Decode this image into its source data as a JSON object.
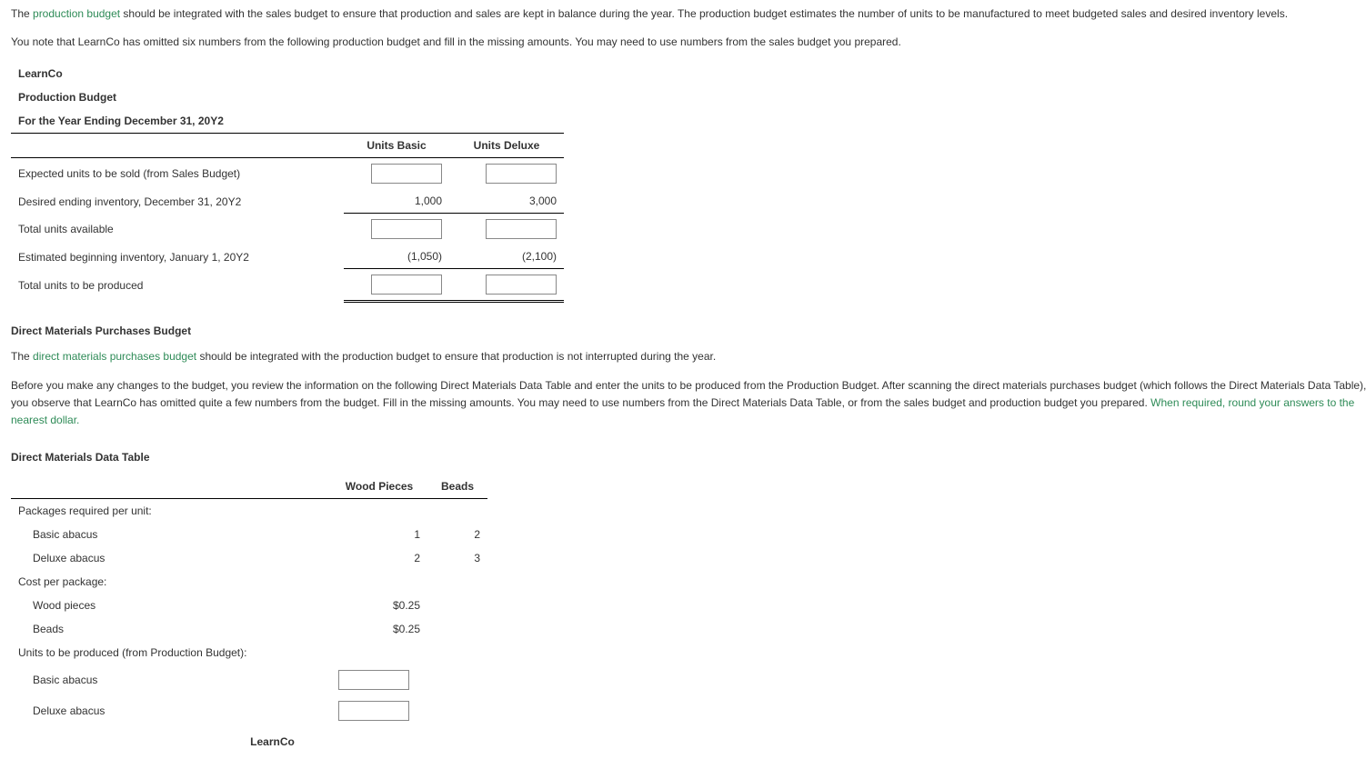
{
  "intro": {
    "p1_a": "The ",
    "p1_link": "production budget",
    "p1_b": " should be integrated with the sales budget to ensure that production and sales are kept in balance during the year. The production budget estimates the number of units to be manufactured to meet budgeted sales and desired inventory levels.",
    "p2": "You note that LearnCo has omitted six numbers from the following production budget and fill in the missing amounts. You may need to use numbers from the sales budget you prepared."
  },
  "prod_budget": {
    "title1": "LearnCo",
    "title2": "Production Budget",
    "title3": "For the Year Ending December 31, 20Y2",
    "col_basic": "Units Basic",
    "col_deluxe": "Units Deluxe",
    "rows": {
      "expected": "Expected units to be sold (from Sales Budget)",
      "desired": "Desired ending inventory, December 31, 20Y2",
      "desired_basic": "1,000",
      "desired_deluxe": "3,000",
      "total_avail": "Total units available",
      "begin_inv": "Estimated beginning inventory, January 1, 20Y2",
      "begin_basic": "(1,050)",
      "begin_deluxe": "(2,100)",
      "total_prod": "Total units to be produced"
    }
  },
  "dm_section": {
    "heading": "Direct Materials Purchases Budget",
    "p1_a": "The ",
    "p1_link": "direct materials purchases budget",
    "p1_b": " should be integrated with the production budget to ensure that production is not interrupted during the year.",
    "p2_a": "Before you make any changes to the budget, you review the information on the following Direct Materials Data Table and enter the units to be produced from the Production Budget. After scanning the direct materials purchases budget (which follows the Direct Materials Data Table), you observe that LearnCo has omitted quite a few numbers from the budget. Fill in the missing amounts. You may need to use numbers from the Direct Materials Data Table, or from the sales budget and production budget you prepared. ",
    "p2_hint": "When required, round your answers to the nearest dollar."
  },
  "dm_table": {
    "heading": "Direct Materials Data Table",
    "col_wood": "Wood Pieces",
    "col_beads": "Beads",
    "rows": {
      "pkg_req": "Packages required per unit:",
      "basic": "Basic abacus",
      "basic_wood": "1",
      "basic_beads": "2",
      "deluxe": "Deluxe abacus",
      "deluxe_wood": "2",
      "deluxe_beads": "3",
      "cost_per_pkg": "Cost per package:",
      "wood_pieces": "Wood pieces",
      "wood_cost": "$0.25",
      "beads_label": "Beads",
      "beads_cost": "$0.25",
      "units_prod": "Units to be produced (from Production Budget):",
      "basic2": "Basic abacus",
      "deluxe2": "Deluxe abacus"
    }
  },
  "footer_title": "LearnCo"
}
